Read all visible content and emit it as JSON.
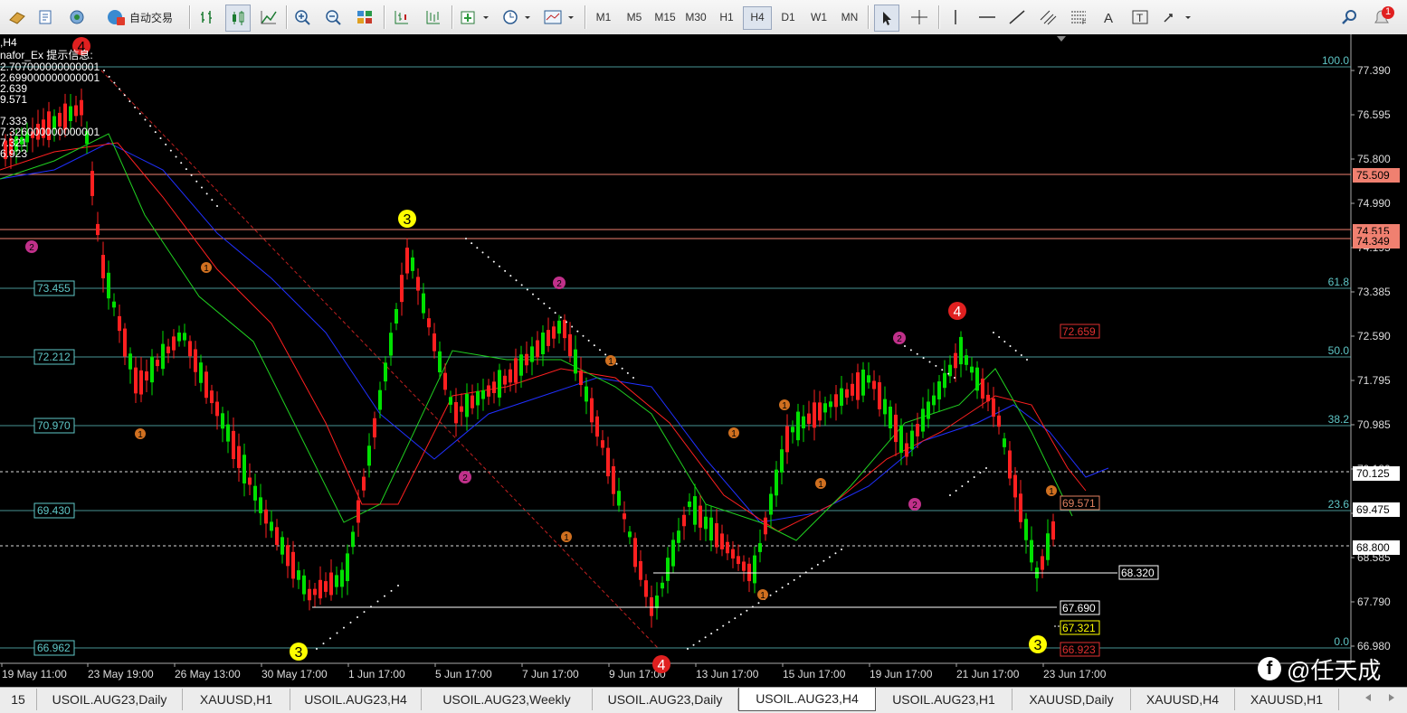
{
  "toolbar": {
    "auto_trading_label": "自动交易",
    "timeframes": [
      "M1",
      "M5",
      "M15",
      "M30",
      "H1",
      "H4",
      "D1",
      "W1",
      "MN"
    ],
    "active_timeframe": "H4",
    "alerts_badge": "1"
  },
  "chart": {
    "symbol_line": ",H4",
    "indicator_title": "nafor_Ex 提示信息:",
    "info_lines": [
      "2.707000000000001",
      "2.699000000000001",
      "2.639",
      "9.571",
      "",
      "7.333",
      "7.326000000000001",
      "7.321",
      "6.923"
    ],
    "price_axis": [
      "77.390",
      "76.595",
      "75.800",
      "74.990",
      "74.195",
      "73.385",
      "72.590",
      "71.795",
      "70.985",
      "70.180",
      "69.385",
      "68.585",
      "67.790",
      "66.980"
    ],
    "time_axis": [
      "19 May 11:00",
      "23 May 19:00",
      "26 May 13:00",
      "30 May 17:00",
      "1 Jun 17:00",
      "5 Jun 17:00",
      "7 Jun 17:00",
      "9 Jun 17:00",
      "13 Jun 17:00",
      "15 Jun 17:00",
      "19 Jun 17:00",
      "21 Jun 17:00",
      "23 Jun 17:00"
    ],
    "fib_levels": [
      {
        "pct": "100.0",
        "price": "77.390"
      },
      {
        "pct": "61.8",
        "price": "73.455"
      },
      {
        "pct": "50.0",
        "price": "72.212"
      },
      {
        "pct": "38.2",
        "price": "70.970"
      },
      {
        "pct": "23.6",
        "price": "69.430"
      },
      {
        "pct": "0.0",
        "price": "66.962"
      }
    ],
    "left_fib_labels": [
      "73.455",
      "72.212",
      "70.970",
      "69.430",
      "66.962"
    ],
    "axis_markers": {
      "res1": "75.509",
      "res2": "74.515",
      "res2b": "74.349",
      "dash1": "70.125",
      "current": "69.475",
      "dash2": "68.800"
    },
    "chart_labels": {
      "l68320": "68.320",
      "l67690": "67.690",
      "l67321": "67.321",
      "l66923": "66.923",
      "l69571": "69.571",
      "l72659": "72.659"
    },
    "wave_labels": [
      "4",
      "3",
      "3",
      "4",
      "3",
      "4"
    ],
    "sub_labels": [
      "1",
      "2"
    ],
    "colors": {
      "bull": "#00e000",
      "bear": "#ff2020",
      "fib": "#5fc7c7",
      "ma_red": "#ff2020",
      "ma_blue": "#2030ff",
      "ma_green": "#20d020"
    }
  },
  "tabs": [
    "15",
    "USOIL.AUG23,Daily",
    "XAUUSD,H1",
    "USOIL.AUG23,H4",
    "USOIL.AUG23,Weekly",
    "USOIL.AUG23,Daily",
    "USOIL.AUG23,H4",
    "USOIL.AUG23,H1",
    "XAUUSD,Daily",
    "XAUUSD,H4",
    "XAUUSD,H1"
  ],
  "active_tab": 6,
  "watermark": "@任天成"
}
